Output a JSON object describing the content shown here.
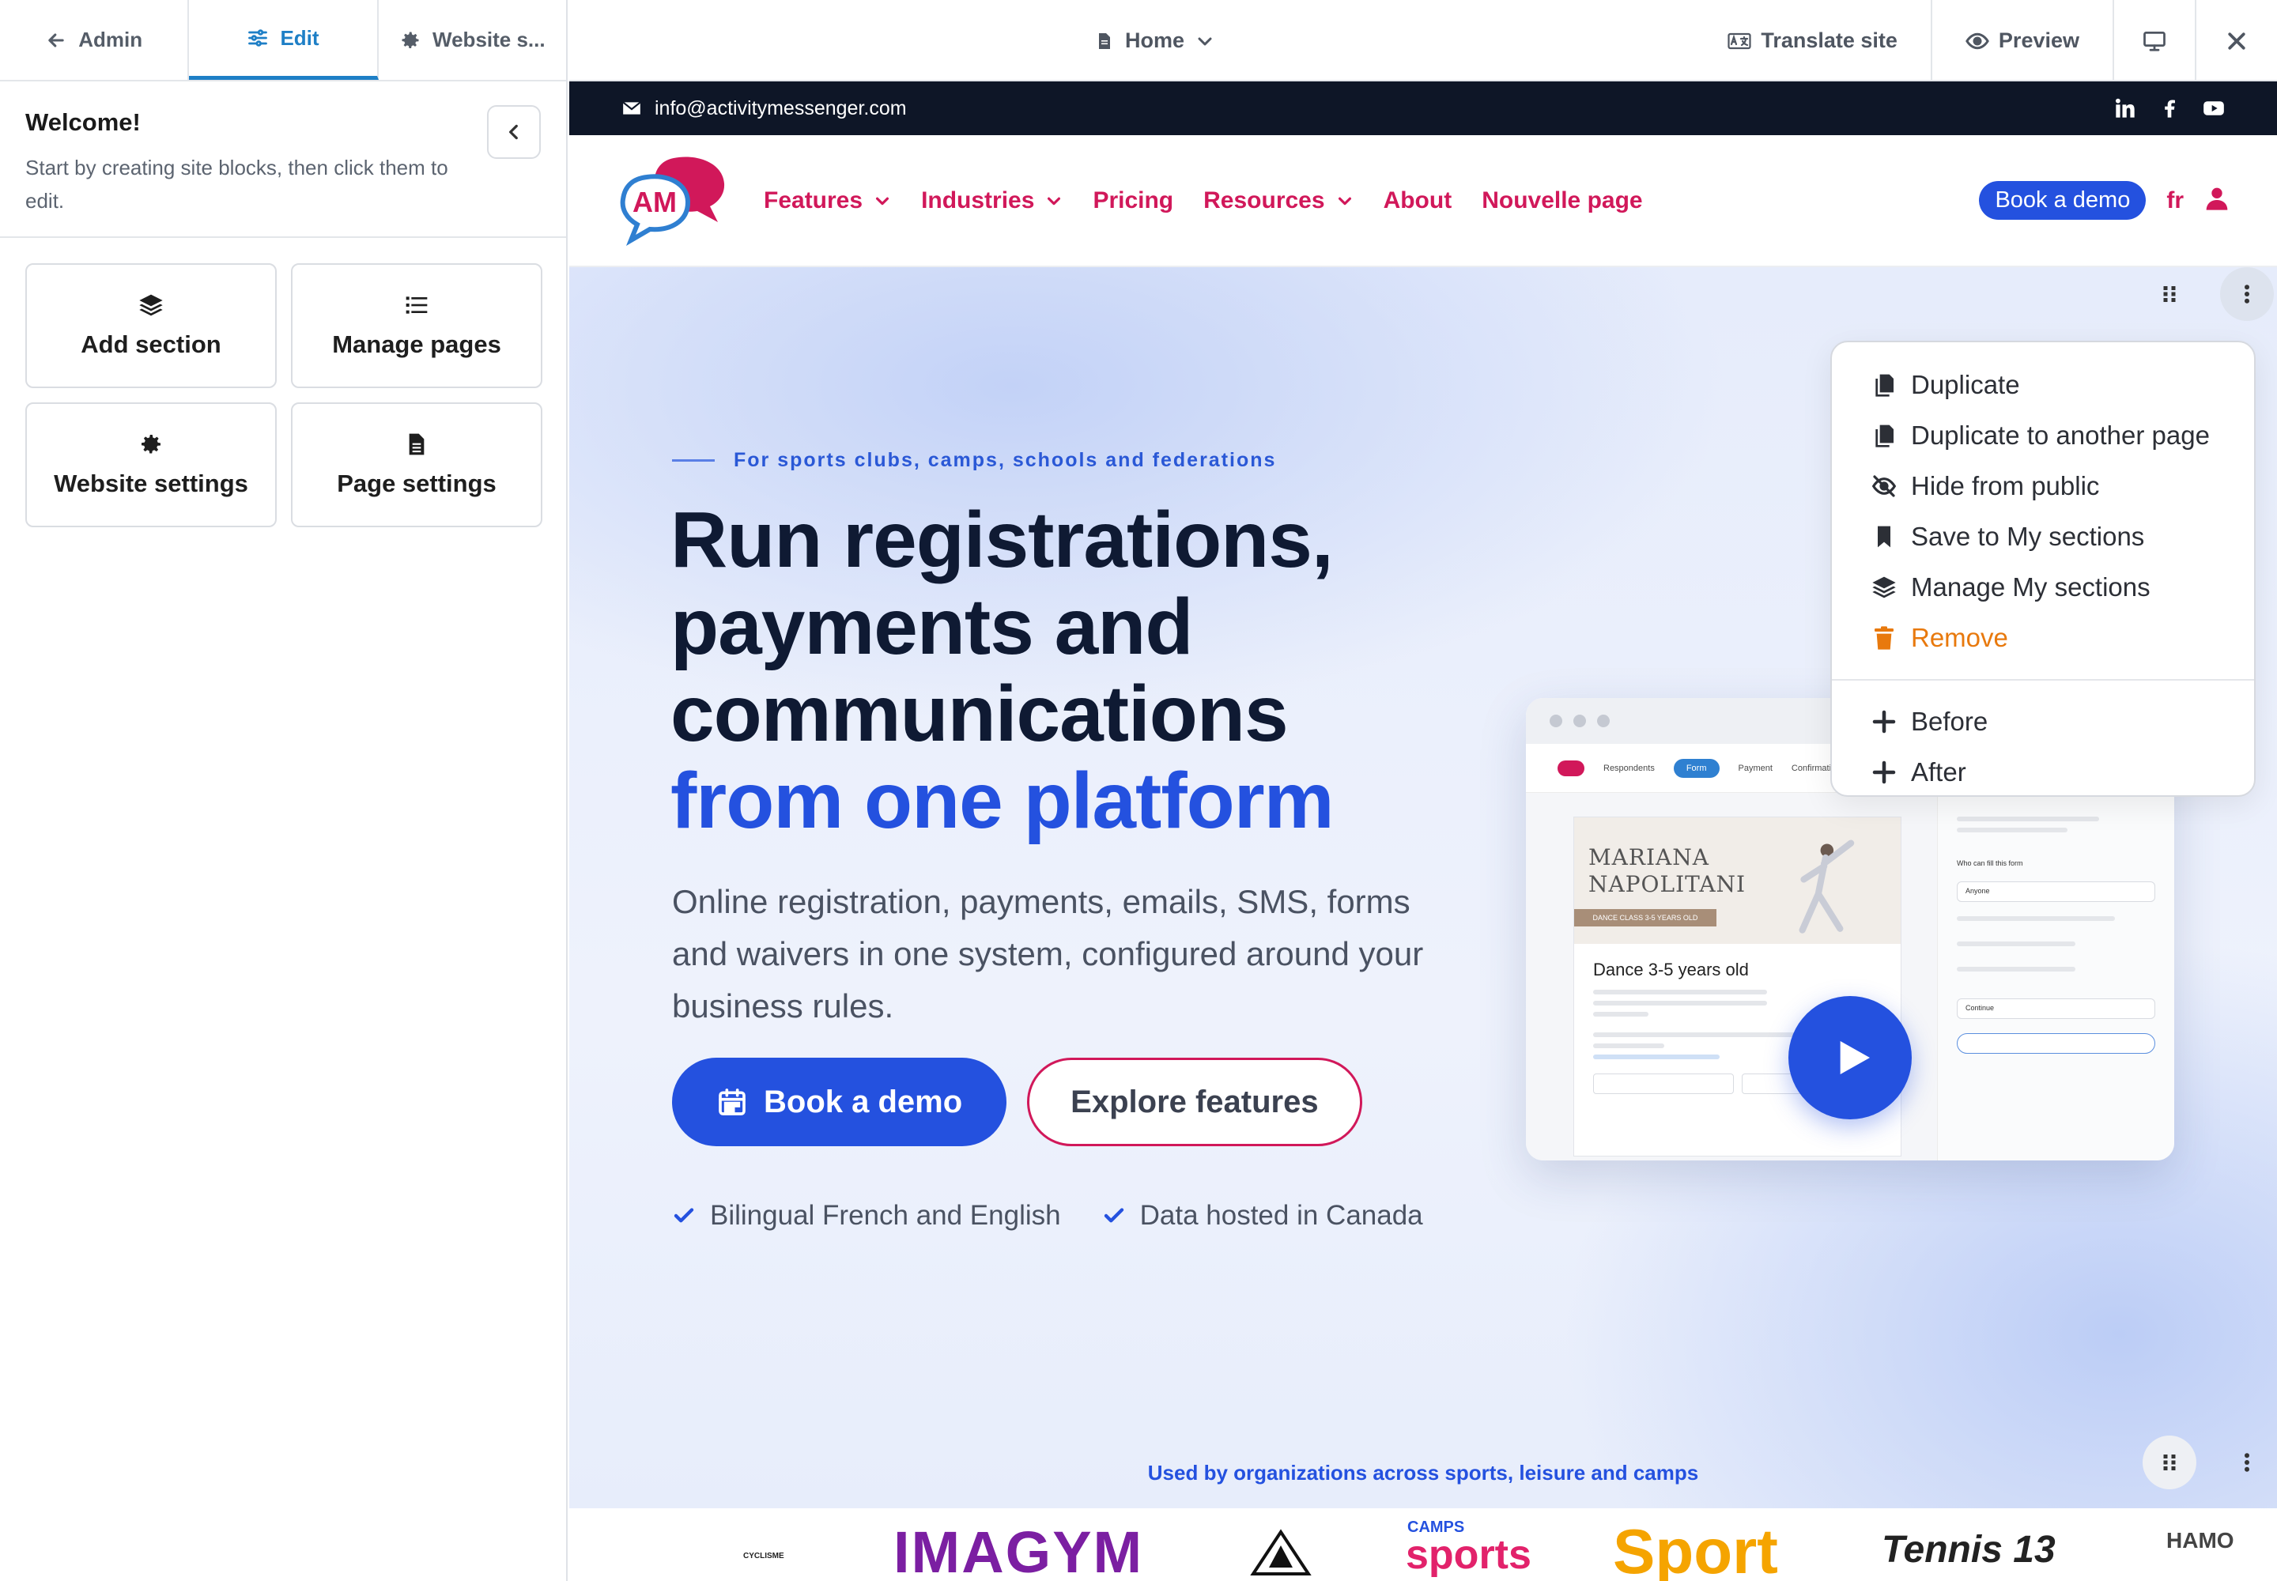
{
  "editor": {
    "tabs": [
      {
        "label": "Admin"
      },
      {
        "label": "Edit"
      },
      {
        "label": "Website s..."
      }
    ],
    "welcome_title": "Welcome!",
    "welcome_text": "Start by creating site blocks, then click them to edit.",
    "cards": [
      {
        "label": "Add section",
        "icon": "layers-icon"
      },
      {
        "label": "Manage pages",
        "icon": "list-icon"
      },
      {
        "label": "Website settings",
        "icon": "gear-icon"
      },
      {
        "label": "Page settings",
        "icon": "document-icon"
      }
    ]
  },
  "topbar": {
    "page_label": "Home",
    "translate_label": "Translate site",
    "preview_label": "Preview"
  },
  "site": {
    "email": "info@activitymessenger.com",
    "logo_text": "AM",
    "menu": [
      {
        "label": "Features",
        "dropdown": true
      },
      {
        "label": "Industries",
        "dropdown": true
      },
      {
        "label": "Pricing",
        "dropdown": false
      },
      {
        "label": "Resources",
        "dropdown": true
      },
      {
        "label": "About",
        "dropdown": false
      },
      {
        "label": "Nouvelle page",
        "dropdown": false
      }
    ],
    "nav_demo_label": "Book a demo",
    "lang_label": "fr",
    "hero": {
      "eyebrow": "For sports clubs, camps, schools and federations",
      "headline_lines": [
        "Run registrations,",
        "payments and",
        "communications"
      ],
      "headline_accent": "from one platform",
      "subhead": "Online registration, payments, emails, SMS, forms and waivers in one system, configured around your business rules.",
      "cta_primary": "Book a demo",
      "cta_secondary": "Explore features",
      "checks": [
        "Bilingual French and English",
        "Data hosted in Canada"
      ]
    },
    "mockup": {
      "tabs": [
        "Respondents",
        "Form",
        "Payment",
        "Confirmation"
      ],
      "banner_name_1": "MARIANA",
      "banner_name_2": "NAPOLITANI",
      "banner_pill": "DANCE CLASS 3-5 YEARS OLD",
      "card_title": "Dance 3-5 years old",
      "side_heading": "Who can fill this form",
      "side_value": "Anyone",
      "side_button": "Continue"
    },
    "logos_title": "Used by organizations across sports, leisure and camps",
    "logos": [
      "CYCLISME",
      "IMAGYM",
      "CAMPS",
      "sports",
      "Sport",
      "Tennis 13",
      "HAMO"
    ]
  },
  "context_menu": {
    "items": [
      {
        "label": "Duplicate",
        "icon": "copy-icon"
      },
      {
        "label": "Duplicate to another page",
        "icon": "copy-icon"
      },
      {
        "label": "Hide from public",
        "icon": "eye-slash-icon"
      },
      {
        "label": "Save to My sections",
        "icon": "bookmark-icon"
      },
      {
        "label": "Manage My sections",
        "icon": "layers-icon"
      },
      {
        "label": "Remove",
        "icon": "trash-icon"
      }
    ],
    "insert_items": [
      {
        "label": "Before"
      },
      {
        "label": "After"
      }
    ]
  },
  "colors": {
    "accent_blue": "#2451df",
    "brand_pink": "#d1185a",
    "editor_blue": "#1e7fc6",
    "danger_orange": "#e8790d",
    "dark_bar": "#0e1627"
  }
}
